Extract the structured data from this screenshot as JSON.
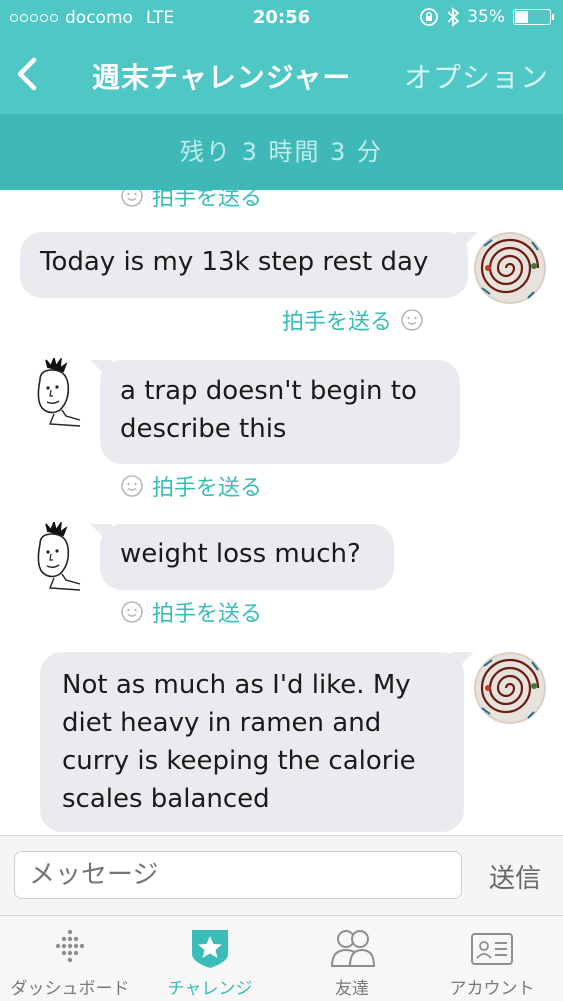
{
  "status_bar": {
    "carrier": "docomo",
    "network": "LTE",
    "time": "20:56",
    "battery": "35%",
    "battery_level": 0.35
  },
  "nav": {
    "title": "週末チャレンジャー",
    "option": "オプション"
  },
  "timer": {
    "text": "残り 3 時間 3 分"
  },
  "chat": {
    "top_clap": "拍手を送る",
    "messages": [
      {
        "sender": "me",
        "text": "Today is my 13k step rest day",
        "clap": "拍手を送る"
      },
      {
        "sender": "other",
        "text": "a trap doesn't begin to describe this",
        "clap": "拍手を送る"
      },
      {
        "sender": "other",
        "text": "weight loss much?",
        "clap": "拍手を送る"
      },
      {
        "sender": "me",
        "text": "Not as much as I'd like. My diet heavy in ramen and curry is keeping the calorie scales balanced"
      }
    ]
  },
  "composer": {
    "placeholder": "メッセージ",
    "send": "送信"
  },
  "tabs": [
    {
      "label": "ダッシュボード",
      "icon": "dashboard-dots-icon"
    },
    {
      "label": "チャレンジ",
      "icon": "challenge-star-icon",
      "active": true
    },
    {
      "label": "友達",
      "icon": "friends-icon"
    },
    {
      "label": "アカウント",
      "icon": "account-card-icon"
    }
  ],
  "colors": {
    "header": "#4fc7c5",
    "timer_bar": "#3fb9b7",
    "accent": "#38bdb9",
    "bubble": "#e9ebef"
  }
}
